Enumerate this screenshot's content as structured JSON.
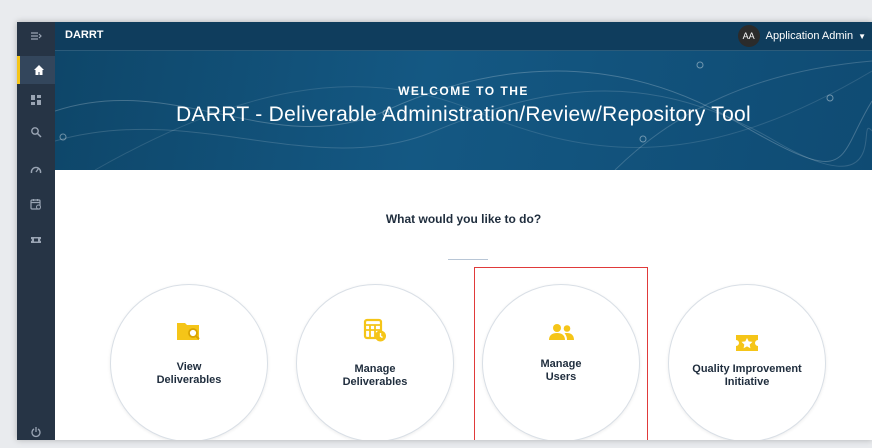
{
  "app": {
    "brand": "DARRT"
  },
  "user": {
    "initials": "AA",
    "name": "Application Admin"
  },
  "hero": {
    "pre_title": "WELCOME TO THE",
    "title": "DARRT - Deliverable Administration/Review/Repository Tool"
  },
  "main": {
    "question": "What would you like to do?",
    "cards": [
      {
        "line1": "View",
        "line2": "Deliverables",
        "icon": "folder-search-icon"
      },
      {
        "line1": "Manage",
        "line2": "Deliverables",
        "icon": "calendar-clock-icon"
      },
      {
        "line1": "Manage",
        "line2": "Users",
        "icon": "users-icon"
      },
      {
        "line1": "Quality Improvement",
        "line2": "Initiative",
        "icon": "star-ticket-icon"
      }
    ]
  },
  "sidebar": {
    "items": [
      "menu-toggle-icon",
      "home-icon",
      "dashboard-icon",
      "search-icon",
      "speedometer-icon",
      "calendar-icon",
      "ticket-icon",
      "power-icon"
    ]
  },
  "colors": {
    "accent": "#f5c518",
    "topbar": "#0f3d5d",
    "sidebar": "#263445",
    "highlight": "#e03a3a"
  }
}
